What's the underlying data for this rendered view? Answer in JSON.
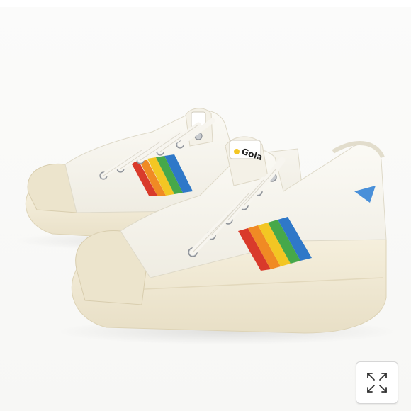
{
  "product_image": {
    "alt": "",
    "brand_logo_text": "Gola",
    "colors": {
      "canvas": "#f8f6ee",
      "sole": "#f1ead6",
      "toe_cap": "#ece4cc",
      "lace": "#f7f5ef",
      "eyelet": "#c9ccd0",
      "side_logo": "#4a90d9",
      "rainbow": [
        "#d93a2b",
        "#f08a24",
        "#f3c623",
        "#46a84a",
        "#2f78c8"
      ]
    }
  },
  "controls": {
    "expand_icon": "expand-arrows-icon"
  }
}
